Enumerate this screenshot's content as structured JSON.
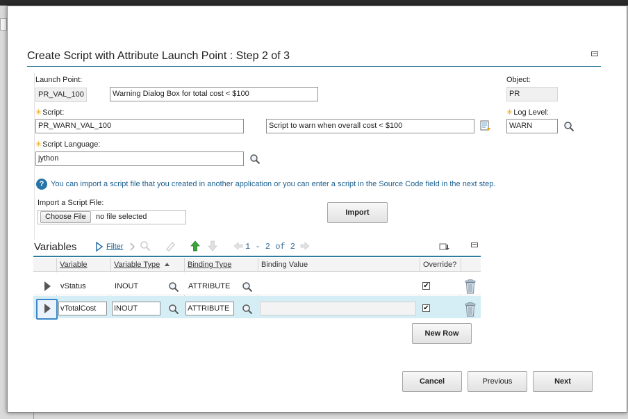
{
  "dialog": {
    "title": "Create Script with Attribute Launch Point : Step 2 of 3"
  },
  "launch_point": {
    "label": "Launch Point:",
    "value": "PR_VAL_100",
    "description": "Warning Dialog Box for total cost < $100"
  },
  "object": {
    "label": "Object:",
    "value": "PR"
  },
  "script": {
    "label": "Script:",
    "value": "PR_WARN_VAL_100",
    "description": "Script to warn when overall cost < $100"
  },
  "log_level": {
    "label": "Log Level:",
    "value": "WARN"
  },
  "script_language": {
    "label": "Script Language:",
    "value": "jython"
  },
  "info": {
    "icon": "?",
    "text": "You can import a script file that you created in another application or you can enter a script in the Source Code field in the next step."
  },
  "import_file": {
    "label": "Import a Script File:",
    "choose_label": "Choose File",
    "status": "no file selected",
    "import_button": "Import"
  },
  "variables": {
    "title": "Variables",
    "filter_label": "Filter",
    "pager_text": "1 - 2 of 2",
    "columns": [
      "Variable",
      "Variable Type",
      "Binding Type",
      "Binding Value",
      "Override?"
    ],
    "rows": [
      {
        "variable": "vStatus",
        "variable_type": "INOUT",
        "binding_type": "ATTRIBUTE",
        "binding_value": "",
        "override_mark": "✔"
      },
      {
        "variable": "vTotalCost",
        "variable_type": "INOUT",
        "binding_type": "ATTRIBUTE",
        "binding_value": "",
        "override_mark": "✔"
      }
    ],
    "new_row_button": "New Row"
  },
  "footer": {
    "cancel": "Cancel",
    "previous": "Previous",
    "next": "Next"
  },
  "colors": {
    "accent_rule": "#2c7da0",
    "link": "#1a5f8f",
    "required_star": "#e8a000",
    "selected_row": "#d5eef5",
    "green_arrow": "#3aa53a"
  }
}
